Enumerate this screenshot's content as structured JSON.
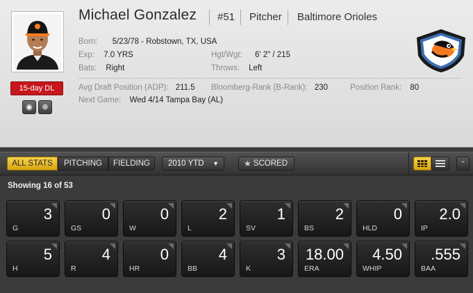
{
  "player": {
    "name": "Michael Gonzalez",
    "number": "#51",
    "position": "Pitcher",
    "team": "Baltimore Orioles",
    "status_badge": "15-day DL"
  },
  "info": {
    "born_label": "Born:",
    "born_value": "5/23/78 - Robstown, TX, USA",
    "exp_label": "Exp:",
    "exp_value": "7.0 YRS",
    "hgtwgt_label": "Hgt/Wgt:",
    "hgtwgt_value": "6' 2\" / 215",
    "bats_label": "Bats:",
    "bats_value": "Right",
    "throws_label": "Throws:",
    "throws_value": "Left",
    "adp_label": "Avg Draft Position (ADP):",
    "adp_value": "211.5",
    "brank_label": "Bloomberg-Rank (B-Rank):",
    "brank_value": "230",
    "posrank_label": "Position Rank:",
    "posrank_value": "80",
    "nextgame_label": "Next Game:",
    "nextgame_value": "Wed 4/14 Tampa Bay (AL)"
  },
  "toolbar": {
    "tabs": [
      "ALL STATS",
      "PITCHING",
      "FIELDING"
    ],
    "active_tab": "ALL STATS",
    "period": "2010 YTD",
    "scored": "SCORED",
    "icons": [
      "grid-view-icon",
      "list-view-icon",
      "collapse-icon"
    ]
  },
  "stats": {
    "showing": "Showing 16 of 53",
    "tiles": [
      {
        "label": "G",
        "value": "3"
      },
      {
        "label": "GS",
        "value": "0"
      },
      {
        "label": "W",
        "value": "0"
      },
      {
        "label": "L",
        "value": "2"
      },
      {
        "label": "SV",
        "value": "1"
      },
      {
        "label": "BS",
        "value": "2"
      },
      {
        "label": "HLD",
        "value": "0"
      },
      {
        "label": "IP",
        "value": "2.0"
      },
      {
        "label": "H",
        "value": "5"
      },
      {
        "label": "R",
        "value": "4"
      },
      {
        "label": "HR",
        "value": "0"
      },
      {
        "label": "BB",
        "value": "4"
      },
      {
        "label": "K",
        "value": "3"
      },
      {
        "label": "ERA",
        "value": "18.00"
      },
      {
        "label": "WHIP",
        "value": "4.50"
      },
      {
        "label": "BAA",
        "value": ".555"
      }
    ]
  },
  "colors": {
    "accent": "#f2c230",
    "badge": "#c8161d",
    "team_orange": "#f47a20"
  }
}
